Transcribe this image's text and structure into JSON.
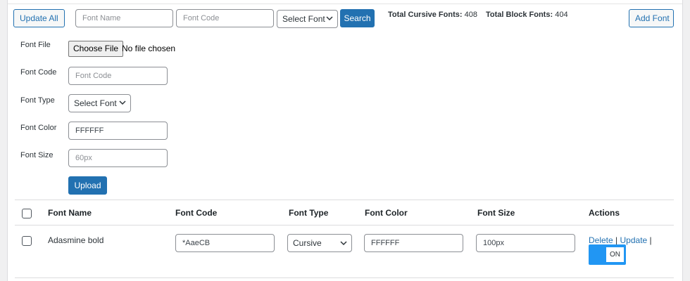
{
  "toolbar": {
    "update_all_label": "Update All",
    "font_name_placeholder": "Font Name",
    "font_code_placeholder": "Font Code",
    "select_font_value": "Select Font",
    "search_label": "Search",
    "total_cursive_label": "Total Cursive Fonts:",
    "total_cursive_value": "408",
    "total_block_label": "Total Block Fonts:",
    "total_block_value": "404",
    "add_font_label": "Add Font"
  },
  "form": {
    "file_label": "Font File",
    "choose_file_label": "Choose File",
    "file_status": "No file chosen",
    "code_label": "Font Code",
    "code_placeholder": "Font Code",
    "type_label": "Font Type",
    "type_value": "Select Font",
    "color_label": "Font Color",
    "color_value": "FFFFFF",
    "size_label": "Font Size",
    "size_placeholder": "60px",
    "upload_label": "Upload"
  },
  "table": {
    "headers": [
      "Font Name",
      "Font Code",
      "Font Type",
      "Font Color",
      "Font Size",
      "Actions"
    ],
    "rows": [
      {
        "name": "Adasmine bold",
        "code": "*AaeCB",
        "type": "Cursive",
        "color": "FFFFFF",
        "size": "100px",
        "delete_label": "Delete",
        "update_label": "Update",
        "separator": "|",
        "toggle_label": "ON"
      }
    ]
  },
  "colors": {
    "accent": "#2271b1",
    "toggle_on": "#2196f3",
    "background": "#f0f0f1"
  }
}
